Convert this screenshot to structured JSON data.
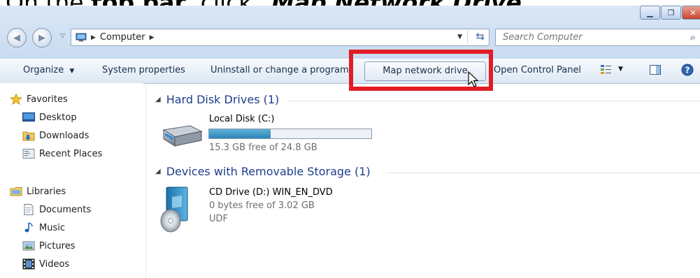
{
  "caption": {
    "prefix": "On the ",
    "bold": "top bar",
    "middle": ", click ",
    "emphasis": "\"Map Network Drive\""
  },
  "window": {
    "controls": [
      "minimize-icon",
      "restore-icon",
      "close-icon"
    ]
  },
  "address_bar": {
    "icon": "computer-icon",
    "crumb": "Computer",
    "refresh_icon": "refresh-icon"
  },
  "search": {
    "placeholder": "Search Computer",
    "icon": "search-icon"
  },
  "command_bar": {
    "organize": "Organize",
    "system_properties": "System properties",
    "uninstall": "Uninstall or change a program",
    "map_network_drive": "Map network drive",
    "open_control_panel": "Open Control Panel",
    "icons": [
      "view-options-icon",
      "preview-pane-icon",
      "help-icon"
    ]
  },
  "highlight_color": "#e11c24",
  "sidebar": {
    "favorites": {
      "label": "Favorites",
      "items": [
        {
          "label": "Desktop",
          "icon": "desktop-icon"
        },
        {
          "label": "Downloads",
          "icon": "downloads-folder-icon"
        },
        {
          "label": "Recent Places",
          "icon": "recent-places-icon"
        }
      ]
    },
    "libraries": {
      "label": "Libraries",
      "items": [
        {
          "label": "Documents",
          "icon": "documents-icon"
        },
        {
          "label": "Music",
          "icon": "music-icon"
        },
        {
          "label": "Pictures",
          "icon": "pictures-icon"
        },
        {
          "label": "Videos",
          "icon": "videos-icon"
        }
      ]
    }
  },
  "content": {
    "hdd_group": "Hard Disk Drives (1)",
    "local_disk": {
      "name": "Local Disk (C:)",
      "free_text": "15.3 GB free of 24.8 GB",
      "used_fraction": 0.38
    },
    "removable_group": "Devices with Removable Storage (1)",
    "cd_drive": {
      "name": "CD Drive (D:) WIN_EN_DVD",
      "free_text": "0 bytes free of 3.02 GB",
      "filesystem": "UDF"
    }
  }
}
